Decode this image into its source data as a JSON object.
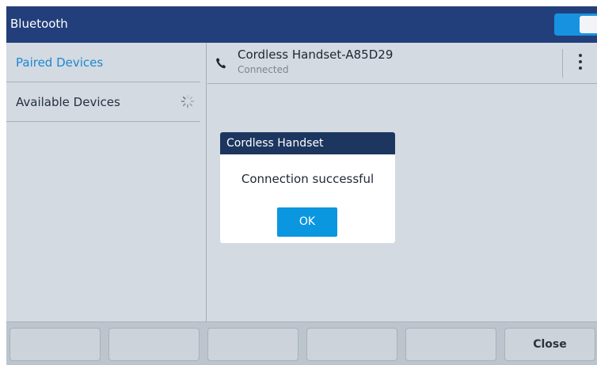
{
  "header": {
    "title": "Bluetooth",
    "bluetooth_enabled": true,
    "toggle_color": "#1792e0",
    "bar_color": "#233f7b"
  },
  "sidebar": {
    "items": [
      {
        "label": "Paired Devices",
        "active": true
      },
      {
        "label": "Available Devices",
        "active": false,
        "icon": "loading-spinner-icon"
      }
    ]
  },
  "device": {
    "icon": "phone-icon",
    "name": "Cordless Handset-A85D29",
    "status": "Connected",
    "menu_icon": "more-vertical-icon"
  },
  "dialog": {
    "title": "Cordless Handset",
    "message": "Connection successful",
    "ok_label": "OK"
  },
  "softkeys": [
    "",
    "",
    "",
    "",
    "",
    "Close"
  ],
  "colors": {
    "accent": "#1f87cf",
    "background": "#d3dae2",
    "dialog_header": "#1c365f",
    "ok_button": "#0b96e0"
  }
}
